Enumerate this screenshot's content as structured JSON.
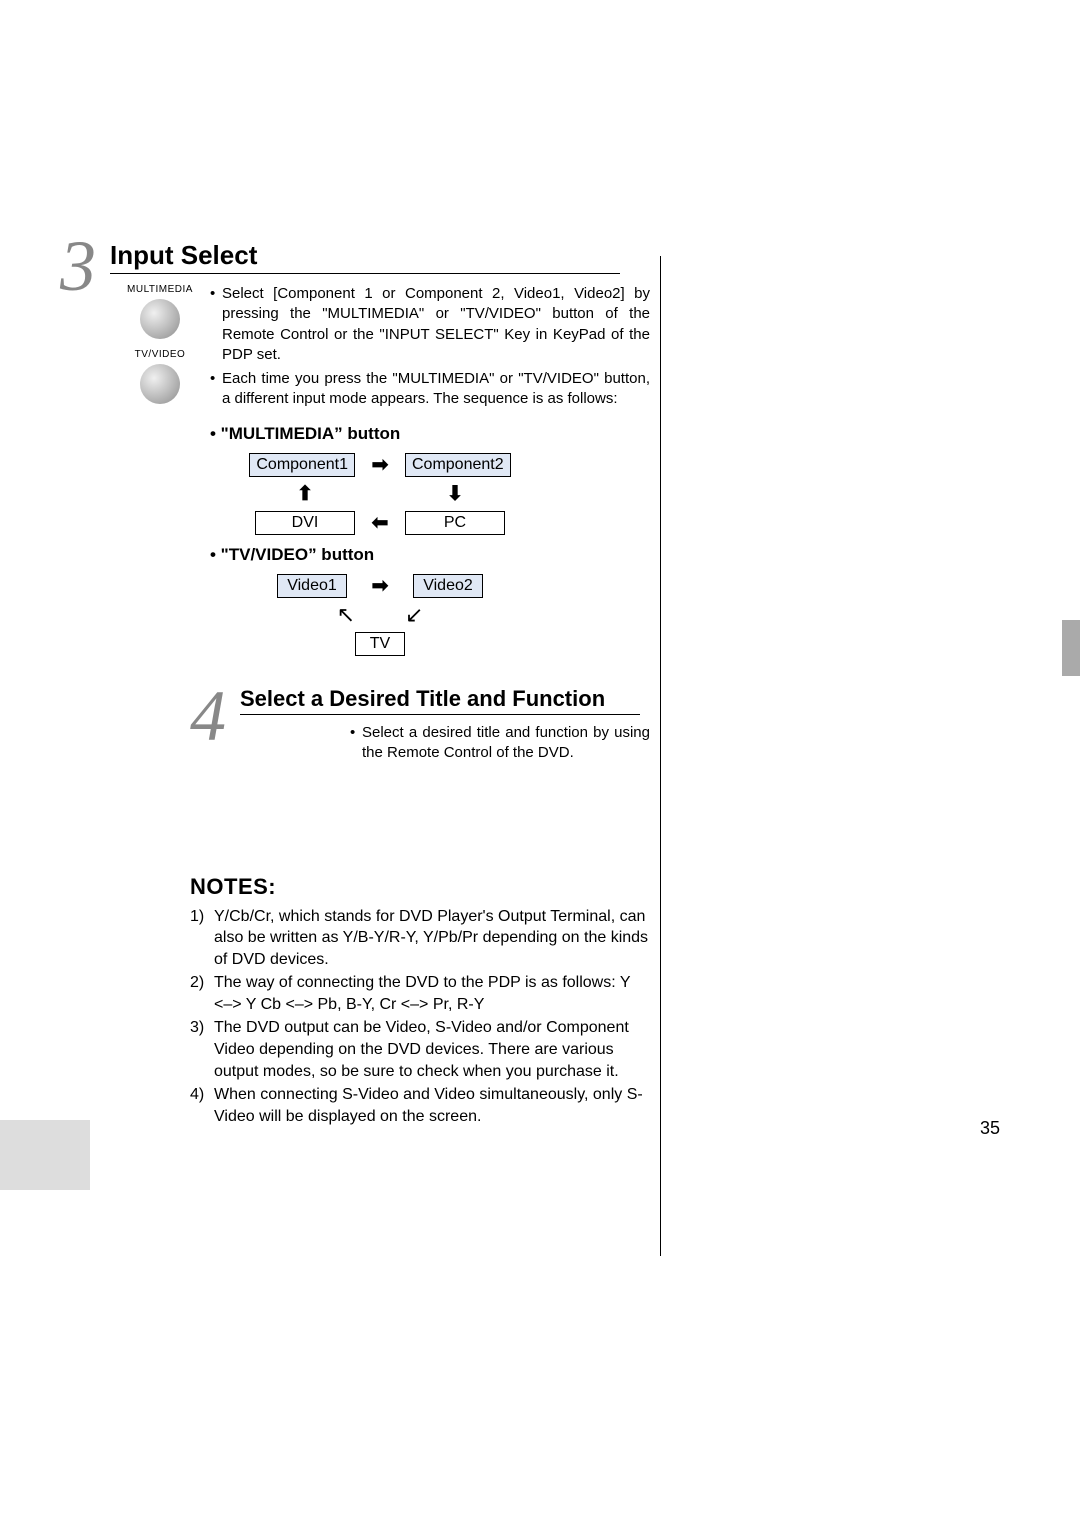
{
  "step3": {
    "title": "Input Select",
    "remote": {
      "label1": "MULTIMEDIA",
      "label2": "TV/VIDEO"
    },
    "bullet1": "Select [Component 1 or Component 2, Video1, Video2] by pressing the \"MULTIMEDIA\" or \"TV/VIDEO\" button of the Remote Control or the \"INPUT SELECT\" Key in KeyPad of the PDP set.",
    "bullet2": "Each time you press the \"MULTIMEDIA\" or \"TV/VIDEO\" button, a different input mode appears. The sequence is as follows:",
    "diag1_label": "• \"MULTIMEDIA” button",
    "diag1": {
      "tl": "Component1",
      "tr": "Component2",
      "bl": "DVI",
      "br": "PC"
    },
    "diag2_label": "• \"TV/VIDEO” button",
    "diag2": {
      "l": "Video1",
      "r": "Video2",
      "b": "TV"
    }
  },
  "step4": {
    "title": "Select a Desired Title and Function",
    "text": "Select a desired title and function by using the Remote Control of the DVD."
  },
  "notes_head": "NOTES:",
  "notes": [
    "Y/Cb/Cr, which stands for DVD Player's Output Terminal, can also be written as Y/B-Y/R-Y, Y/Pb/Pr depending on the kinds of DVD devices.",
    "The way of connecting the DVD to the PDP is as follows: Y <–> Y    Cb <–> Pb, B-Y,    Cr <–> Pr, R-Y",
    "The DVD output can be Video, S-Video and/or Component Video depending on the DVD devices. There are various output modes, so be sure to check when you purchase it.",
    "When connecting S-Video and Video simultaneously, only S-Video will be displayed on the screen."
  ],
  "pagenum": "35"
}
